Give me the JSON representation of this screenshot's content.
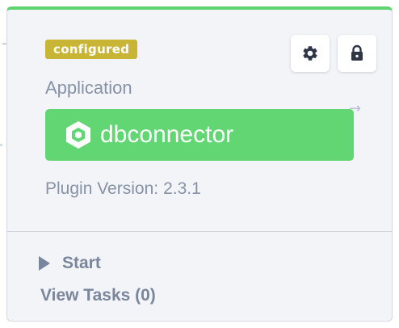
{
  "card": {
    "status_badge": "configured",
    "type_label": "Application",
    "name": "dbconnector",
    "version_label": "Plugin Version:",
    "version_value": "2.3.1",
    "toolbar": {
      "settings_icon": "gear-icon",
      "lock_icon": "lock-icon"
    },
    "actions": {
      "start_label": "Start",
      "start_icon": "play-icon",
      "view_tasks_label": "View Tasks (0)"
    },
    "app_icon": "hexagon-icon"
  },
  "colors": {
    "accent_green": "#62d672",
    "top_border_green": "#5fd36f",
    "badge_yellow": "#c9b535",
    "muted_text": "#8792a6",
    "card_background": "#f2f4f8",
    "icon_dark": "#2e3646"
  }
}
